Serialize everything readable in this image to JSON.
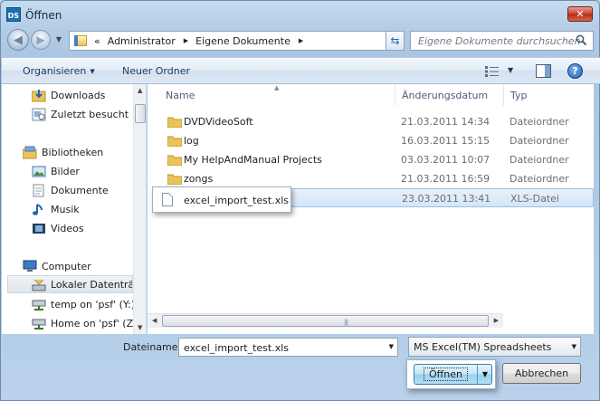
{
  "window": {
    "title": "Öffnen",
    "app_icon_text": "DS",
    "close_label": "✕"
  },
  "address": {
    "prefix": "«",
    "segments": [
      "Administrator",
      "Eigene Dokumente"
    ],
    "search_placeholder": "Eigene Dokumente durchsuchen"
  },
  "toolbar": {
    "organize_label": "Organisieren",
    "new_folder_label": "Neuer Ordner",
    "help_label": "?"
  },
  "nav": {
    "items": [
      {
        "label": "Downloads",
        "icon": "downloads-folder-icon"
      },
      {
        "label": "Zuletzt besucht",
        "icon": "recent-places-icon"
      },
      {
        "label": "Bibliotheken",
        "icon": "libraries-icon"
      },
      {
        "label": "Bilder",
        "icon": "pictures-icon"
      },
      {
        "label": "Dokumente",
        "icon": "documents-icon"
      },
      {
        "label": "Musik",
        "icon": "music-icon"
      },
      {
        "label": "Videos",
        "icon": "videos-icon"
      },
      {
        "label": "Computer",
        "icon": "computer-icon"
      },
      {
        "label": "Lokaler Datenträger",
        "icon": "local-disk-icon",
        "selected": true
      },
      {
        "label": "temp on 'psf' (Y:)",
        "icon": "network-drive-icon"
      },
      {
        "label": "Home on 'psf' (Z",
        "icon": "network-drive-icon"
      }
    ]
  },
  "files": {
    "columns": {
      "name": "Name",
      "date": "Änderungsdatum",
      "type": "Typ"
    },
    "rows": [
      {
        "name": "DVDVideoSoft",
        "date": "21.03.2011 14:34",
        "type": "Dateiordner",
        "kind": "folder"
      },
      {
        "name": "log",
        "date": "16.03.2011 15:15",
        "type": "Dateiordner",
        "kind": "folder"
      },
      {
        "name": "My HelpAndManual Projects",
        "date": "03.03.2011 10:07",
        "type": "Dateiordner",
        "kind": "folder"
      },
      {
        "name": "zongs",
        "date": "21.03.2011 16:59",
        "type": "Dateiordner",
        "kind": "folder"
      },
      {
        "name": "excel_import_test.xls",
        "date": "23.03.2011 13:41",
        "type": "XLS-Datei",
        "kind": "file",
        "selected": true
      }
    ]
  },
  "bottom": {
    "filename_label": "Dateiname:",
    "filename_value": "excel_import_test.xls",
    "filetype_value": "MS Excel(TM) Spreadsheets",
    "open_label": "Öffnen",
    "cancel_label": "Abbrechen"
  },
  "colors": {
    "folder": "#e8c45a",
    "selection": "#d4e6f8",
    "accent": "#3c7fb1"
  }
}
